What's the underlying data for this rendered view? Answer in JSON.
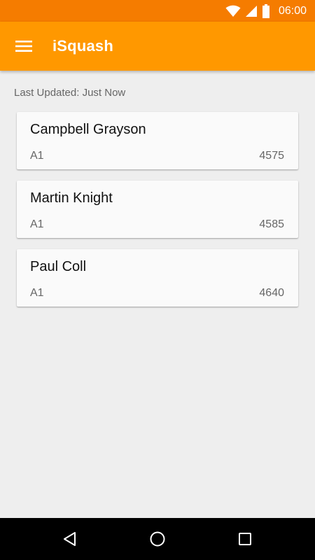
{
  "status_bar": {
    "time": "06:00",
    "icons": [
      "wifi-icon",
      "cellular-signal-icon",
      "battery-icon"
    ]
  },
  "app_bar": {
    "title": "iSquash",
    "menu_icon": "hamburger-menu-icon"
  },
  "last_updated": "Last Updated: Just Now",
  "players": [
    {
      "name": "Campbell Grayson",
      "division": "A1",
      "points": "4575"
    },
    {
      "name": "Martin Knight",
      "division": "A1",
      "points": "4585"
    },
    {
      "name": "Paul Coll",
      "division": "A1",
      "points": "4640"
    }
  ],
  "nav_bar": {
    "icons": [
      "back-icon",
      "home-icon",
      "recents-icon"
    ]
  },
  "colors": {
    "status_bar": "#f57c00",
    "app_bar": "#ff9800",
    "background": "#eeeeee",
    "card": "#fafafa"
  }
}
